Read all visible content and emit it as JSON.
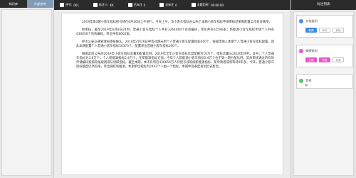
{
  "left_panel": {
    "tabs": [
      {
        "label": "知识库"
      },
      {
        "label": "外部参考"
      }
    ]
  },
  "topbar": {
    "seq_label": "序号:",
    "seq_value": "001",
    "annotator_label": "标注人:",
    "annotator_value": "KK",
    "done_label": "已标注",
    "done_value": "0",
    "total_label": "总标注",
    "total_value": "0",
    "time_label": "本题用时:",
    "time_value": "00:00:00"
  },
  "document": {
    "paragraphs": [
      "2019年第3期小客车指标摇号将在6月26日上午进行。今天上午，市小客车指标办公布了本期小客车指标申请审核结果和配置工作有关事项。",
      "经审核，截至2019年6月8日24时，普通小客车指标个人共有3264069个有效编码，单位共有62596家；新能源小客车指标申请个人共有430656个有效编码，单位共有8602家。",
      "经市公安交通管理局审核确认，2018年4月26日中签过期未用个人普通小客车配置指标640个。按规定纳入本期个人普通小客车指标配置，因此本期配置个人普通小客车指标56373个；配置单位普通小客车指标266个。",
      "根据此前公布的2019年小客车指标总量和配置比例，2019年全年小客车指标年度配额为10万个。指标总量与2018年持平。其中，个人普通车指标为3.8万个，个人新能源指标5.4万个。在新能源指标方面，今年个人新能源小客车指标5.4万个位于第一期分配比例，其余审核通过的有效申请编码按照轮候规则排队领取指标。截至本期，本市有将近436656万人待摇号或等候新能源指标，新申请者或将等待9年多。今年，普通小客车指标额度仍然有限，单位调控将推进。本期单位指标为2462个人拍一个指标，本期申签难度再创历史新高。"
    ]
  },
  "right_panel": {
    "title": "标注列表",
    "cards": [
      {
        "label": "文档类别",
        "color": "#4a90e2",
        "buttons": [
          "新闻",
          "评论",
          "其他"
        ],
        "button_colors": [
          "#3c8de3",
          "",
          ""
        ]
      },
      {
        "label": "情感倾向",
        "color": "#e05ad9",
        "buttons": [
          "正面",
          "中性",
          "负面"
        ],
        "button_colors": [
          "#e35ac8",
          "#e35ac8",
          ""
        ]
      }
    ],
    "small_card": {
      "label": "其他",
      "color": "#58c46a"
    }
  },
  "icons": {
    "seq": "seq-icon",
    "user": "user-icon",
    "check": "check-icon",
    "list": "list-icon",
    "clock": "clock-icon"
  }
}
